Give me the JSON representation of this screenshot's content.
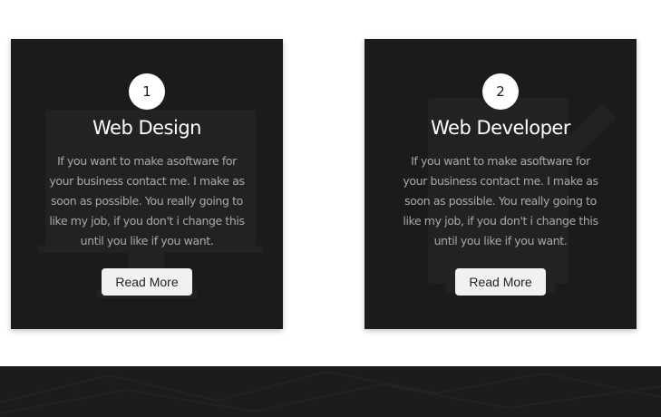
{
  "cards": [
    {
      "number": "1",
      "title": "Web Design",
      "description": "If you want to make asoftware for your business contact me. I make as soon as possible. You really going to like my job, if you don't i change this until you like if you want.",
      "button_label": "Read More",
      "background_icon": "monitor-icon"
    },
    {
      "number": "2",
      "title": "Web Developer",
      "description": "If you want to make asoftware for your business contact me. I make as soon as possible. You really going to like my job, if you don't i change this until you like if you want.",
      "button_label": "Read More",
      "background_icon": "pencil-icon"
    }
  ],
  "colors": {
    "card_background": "#1b1b1b",
    "text_primary": "#ffffff",
    "text_muted": "#a9a9a9",
    "button_background": "#f1f1f1",
    "footer_background": "#1c1c1c",
    "page_background": "#ffffff"
  }
}
